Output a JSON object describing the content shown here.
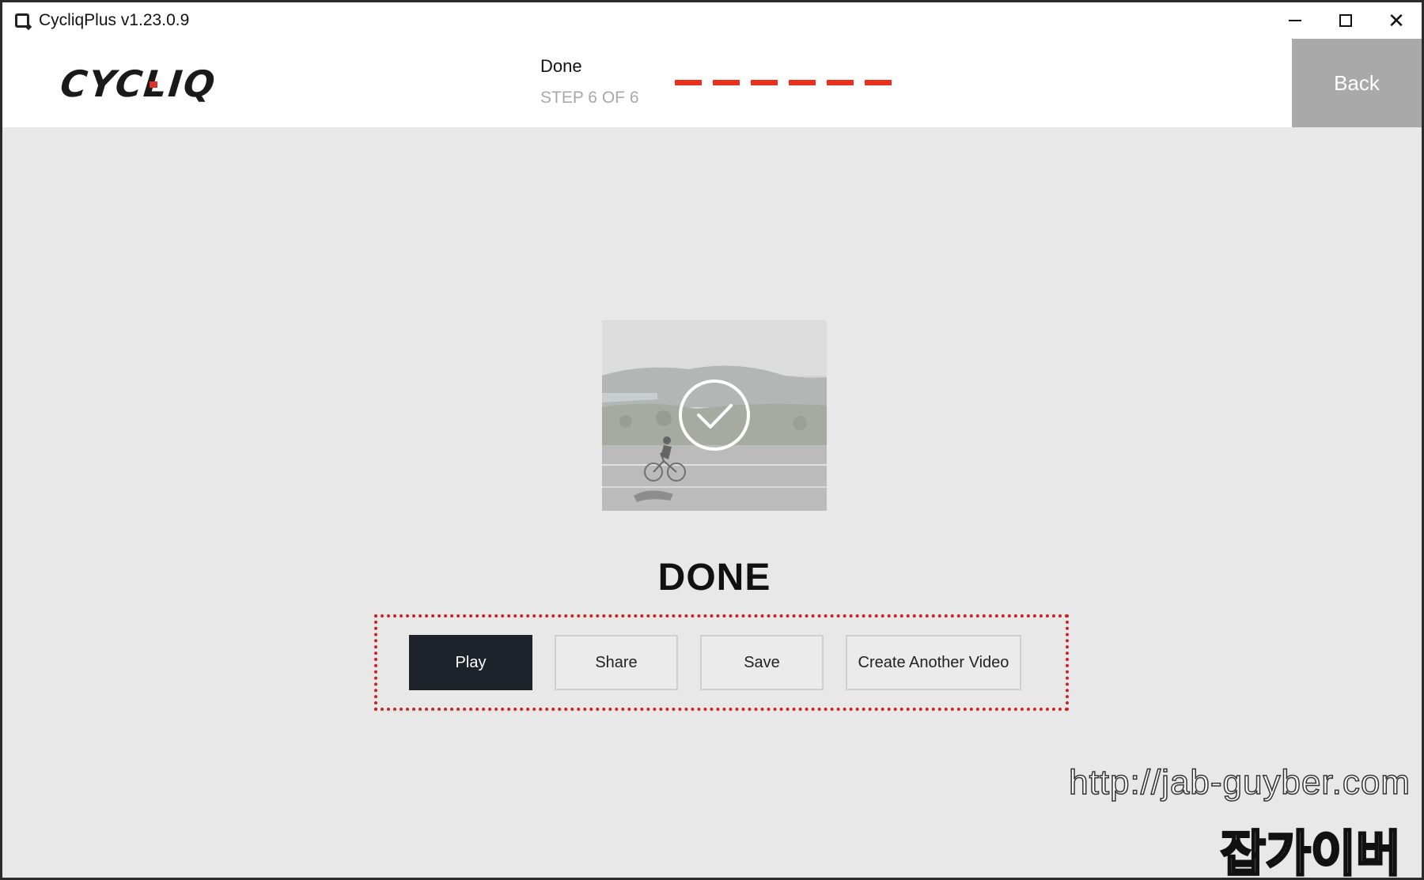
{
  "window": {
    "title": "CycliqPlus v1.23.0.9"
  },
  "header": {
    "logo_text": "CYCLIQ",
    "step_title": "Done",
    "step_counter": "STEP 6 OF 6",
    "progress_total": 6,
    "progress_done": 6,
    "back_label": "Back"
  },
  "main": {
    "heading": "DONE",
    "actions": {
      "play_label": "Play",
      "share_label": "Share",
      "save_label": "Save",
      "create_label": "Create Another Video"
    }
  },
  "watermark": {
    "url": "http://jab-guyber.com",
    "name": "잡가이버"
  },
  "colors": {
    "accent": "#e8321e",
    "play_button": "#1e232b",
    "back_button": "#a9a9a9",
    "highlight_frame": "#d41f1f"
  },
  "icons": [
    "app-icon",
    "minimize-icon",
    "maximize-icon",
    "close-icon",
    "checkmark-circle-icon"
  ]
}
